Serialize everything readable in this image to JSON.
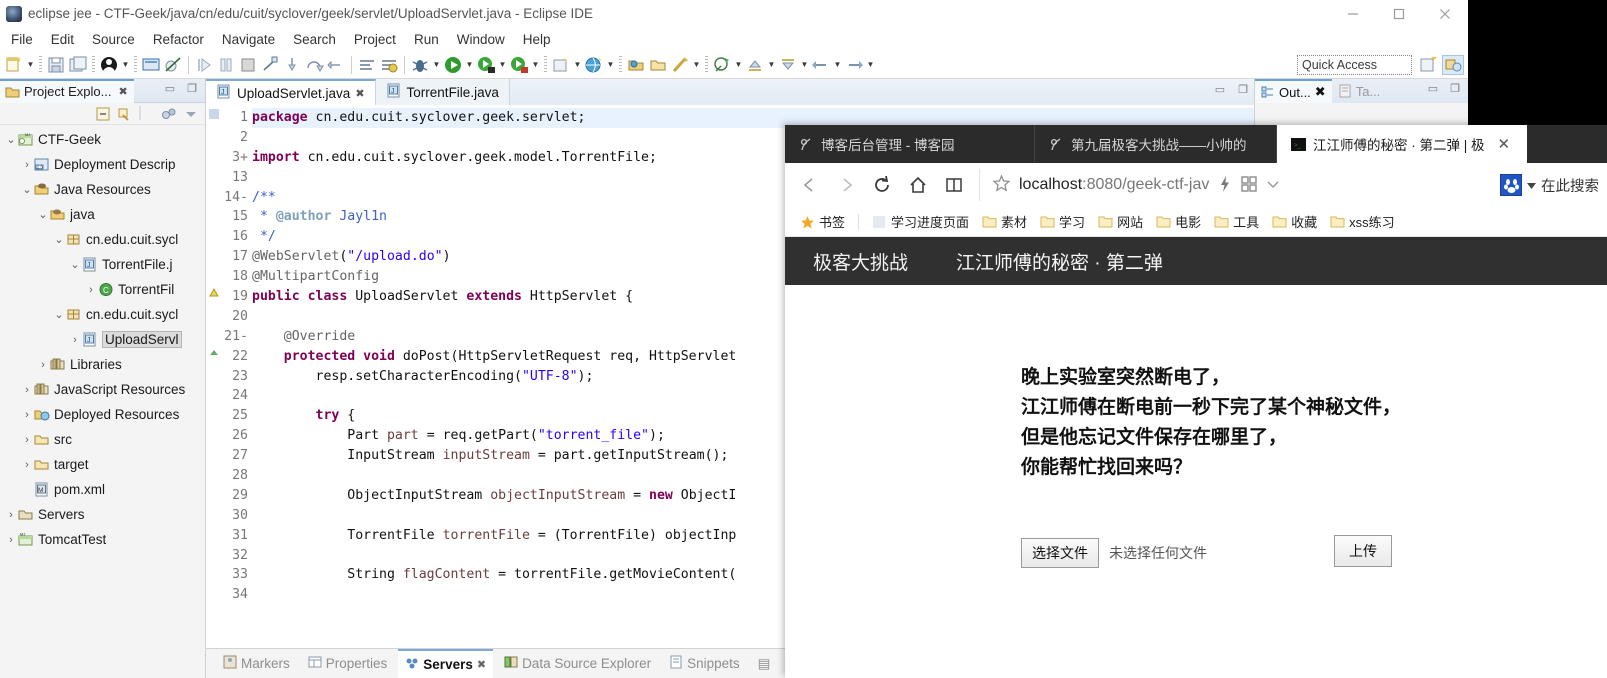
{
  "eclipse": {
    "title": "eclipse jee - CTF-Geek/java/cn/edu/cuit/syclover/geek/servlet/UploadServlet.java - Eclipse IDE",
    "window_controls": {
      "minimize": "minimize-button",
      "maximize": "maximize-button",
      "close": "close-button"
    },
    "menu": [
      "File",
      "Edit",
      "Source",
      "Refactor",
      "Navigate",
      "Search",
      "Project",
      "Run",
      "Window",
      "Help"
    ],
    "quick_access": "Quick Access",
    "explorer": {
      "tab_label": "Project Explo...",
      "tree": [
        {
          "indent": 0,
          "twist": "v",
          "icon": "project-icon",
          "label": "CTF-Geek",
          "selected": false
        },
        {
          "indent": 1,
          "twist": ">",
          "icon": "deployment-icon",
          "label": "Deployment Descrip",
          "selected": false
        },
        {
          "indent": 1,
          "twist": "v",
          "icon": "java-resources-icon",
          "label": "Java Resources",
          "selected": false
        },
        {
          "indent": 2,
          "twist": "v",
          "icon": "source-folder-icon",
          "label": "java",
          "selected": false
        },
        {
          "indent": 3,
          "twist": "v",
          "icon": "package-icon",
          "label": "cn.edu.cuit.sycl",
          "selected": false
        },
        {
          "indent": 4,
          "twist": "v",
          "icon": "java-file-icon",
          "label": "TorrentFile.j",
          "selected": false
        },
        {
          "indent": 5,
          "twist": ">",
          "icon": "class-icon",
          "label": "TorrentFil",
          "selected": false
        },
        {
          "indent": 3,
          "twist": "v",
          "icon": "package-icon",
          "label": "cn.edu.cuit.sycl",
          "selected": false
        },
        {
          "indent": 4,
          "twist": ">",
          "icon": "java-file-icon",
          "label": "UploadServl",
          "selected": true
        },
        {
          "indent": 2,
          "twist": ">",
          "icon": "library-icon",
          "label": "Libraries",
          "selected": false
        },
        {
          "indent": 1,
          "twist": ">",
          "icon": "library-icon",
          "label": "JavaScript Resources",
          "selected": false
        },
        {
          "indent": 1,
          "twist": ">",
          "icon": "deployed-icon",
          "label": "Deployed Resources",
          "selected": false
        },
        {
          "indent": 1,
          "twist": ">",
          "icon": "folder-icon",
          "label": "src",
          "selected": false
        },
        {
          "indent": 1,
          "twist": ">",
          "icon": "folder-icon",
          "label": "target",
          "selected": false
        },
        {
          "indent": 1,
          "twist": "",
          "icon": "xml-file-icon",
          "label": "pom.xml",
          "selected": false
        },
        {
          "indent": 0,
          "twist": ">",
          "icon": "servers-icon",
          "label": "Servers",
          "selected": false
        },
        {
          "indent": 0,
          "twist": ">",
          "icon": "server-icon",
          "label": "TomcatTest",
          "selected": false
        }
      ]
    },
    "editor_tabs": [
      {
        "label": "TorrentFile.java",
        "active": false,
        "dirty": false
      },
      {
        "label": "UploadServlet.java",
        "active": true,
        "dirty": true
      }
    ],
    "code_lines": [
      {
        "no": "1",
        "fold": "",
        "mark": "bp",
        "html": "<span class=\"kw\">package</span> cn.edu.cuit.syclover.geek.servlet;",
        "highlight": true
      },
      {
        "no": "2",
        "fold": "",
        "mark": "",
        "html": ""
      },
      {
        "no": "3",
        "fold": "+",
        "mark": "",
        "html": "<span class=\"kw\">import</span> cn.edu.cuit.syclover.geek.model.TorrentFile;"
      },
      {
        "no": "13",
        "fold": "",
        "mark": "",
        "html": ""
      },
      {
        "no": "14",
        "fold": "-",
        "mark": "",
        "html": "<span class=\"jdoc\">/**</span>"
      },
      {
        "no": "15",
        "fold": "",
        "mark": "",
        "html": " <span class=\"jdoc\">* </span><span class=\"jtag\">@author</span><span class=\"jdoc\"> Jayl1n</span>"
      },
      {
        "no": "16",
        "fold": "",
        "mark": "",
        "html": " <span class=\"jdoc\">*/</span>"
      },
      {
        "no": "17",
        "fold": "",
        "mark": "",
        "html": "<span class=\"ann\">@WebServlet</span>(<span class=\"str\">\"/upload.do\"</span>)"
      },
      {
        "no": "18",
        "fold": "",
        "mark": "",
        "html": "<span class=\"ann\">@MultipartConfig</span>"
      },
      {
        "no": "19",
        "fold": "",
        "mark": "w",
        "html": "<span class=\"kw\">public class</span> UploadServlet <span class=\"kw\">extends</span> HttpServlet {"
      },
      {
        "no": "20",
        "fold": "",
        "mark": "",
        "html": ""
      },
      {
        "no": "21",
        "fold": "-",
        "mark": "",
        "html": "    <span class=\"ann\">@Override</span>"
      },
      {
        "no": "22",
        "fold": "",
        "mark": "o",
        "html": "    <span class=\"kw\">protected void</span> doPost(HttpServletRequest req, HttpServlet"
      },
      {
        "no": "23",
        "fold": "",
        "mark": "",
        "html": "        resp.setCharacterEncoding(<span class=\"str\">\"UTF-8\"</span>);"
      },
      {
        "no": "24",
        "fold": "",
        "mark": "",
        "html": ""
      },
      {
        "no": "25",
        "fold": "",
        "mark": "",
        "html": "        <span class=\"kw\">try</span> {"
      },
      {
        "no": "26",
        "fold": "",
        "mark": "",
        "html": "            Part <span class=\"loc\">part</span> = req.getPart(<span class=\"str\">\"torrent_file\"</span>);"
      },
      {
        "no": "27",
        "fold": "",
        "mark": "",
        "html": "            InputStream <span class=\"loc\">inputStream</span> = part.getInputStream();"
      },
      {
        "no": "28",
        "fold": "",
        "mark": "",
        "html": ""
      },
      {
        "no": "29",
        "fold": "",
        "mark": "",
        "html": "            ObjectInputStream <span class=\"loc\">objectInputStream</span> = <span class=\"kw\">new</span> ObjectI"
      },
      {
        "no": "30",
        "fold": "",
        "mark": "",
        "html": ""
      },
      {
        "no": "31",
        "fold": "",
        "mark": "",
        "html": "            TorrentFile <span class=\"loc\">torrentFile</span> = (TorrentFile) objectInp"
      },
      {
        "no": "32",
        "fold": "",
        "mark": "",
        "html": ""
      },
      {
        "no": "33",
        "fold": "",
        "mark": "",
        "html": "            String <span class=\"loc\">flagContent</span> = torrentFile.getMovieContent("
      },
      {
        "no": "34",
        "fold": "",
        "mark": "",
        "html": ""
      }
    ],
    "outline_tabs": [
      {
        "label": "Out...",
        "active": true
      },
      {
        "label": "Ta...",
        "active": false
      }
    ],
    "bottom_tabs": [
      {
        "label": "Markers",
        "icon": "markers-icon",
        "active": false
      },
      {
        "label": "Properties",
        "icon": "properties-icon",
        "active": false
      },
      {
        "label": "Servers",
        "icon": "servers-icon",
        "active": true
      },
      {
        "label": "Data Source Explorer",
        "icon": "datasource-icon",
        "active": false
      },
      {
        "label": "Snippets",
        "icon": "snippets-icon",
        "active": false
      }
    ]
  },
  "browser": {
    "tabs": [
      {
        "label": "博客后台管理 - 博客园",
        "favicon": "page-icon",
        "active": false,
        "closable": false
      },
      {
        "label": "第九届极客大挑战——小帅的",
        "favicon": "page-icon",
        "active": false,
        "closable": false
      },
      {
        "label": "江江师傅的秘密 · 第二弹 | 极",
        "favicon": "site-icon",
        "active": true,
        "closable": true
      }
    ],
    "close_label": "✕",
    "nav": {
      "back": "back-icon",
      "forward": "forward-icon",
      "reload": "reload-icon",
      "home": "home-icon",
      "reader": "reader-icon",
      "star": "bookmark-star-icon"
    },
    "url_prefix": "localhost",
    "url_rest": ":8080/geek-ctf-jav",
    "search_label": "在此搜索",
    "bookmarks": [
      {
        "label": "书签",
        "icon": "star-icon"
      },
      {
        "label": "学习进度页面",
        "icon": "page-icon"
      },
      {
        "label": "素材",
        "icon": "folder-icon"
      },
      {
        "label": "学习",
        "icon": "folder-icon"
      },
      {
        "label": "网站",
        "icon": "folder-icon"
      },
      {
        "label": "电影",
        "icon": "folder-icon"
      },
      {
        "label": "工具",
        "icon": "folder-icon"
      },
      {
        "label": "收藏",
        "icon": "folder-icon"
      },
      {
        "label": "xss练习",
        "icon": "folder-icon"
      }
    ],
    "site": {
      "brand": "极客大挑战",
      "subtitle": "江江师傅的秘密 · 第二弹",
      "riddle_lines": [
        "晚上实验室突然断电了，",
        "江江师傅在断电前一秒下完了某个神秘文件，",
        "但是他忘记文件保存在哪里了，",
        "你能帮忙找回来吗？"
      ],
      "file_button": "选择文件",
      "file_status": "未选择任何文件",
      "upload_button": "上传",
      "header_bg": "#303030"
    }
  }
}
